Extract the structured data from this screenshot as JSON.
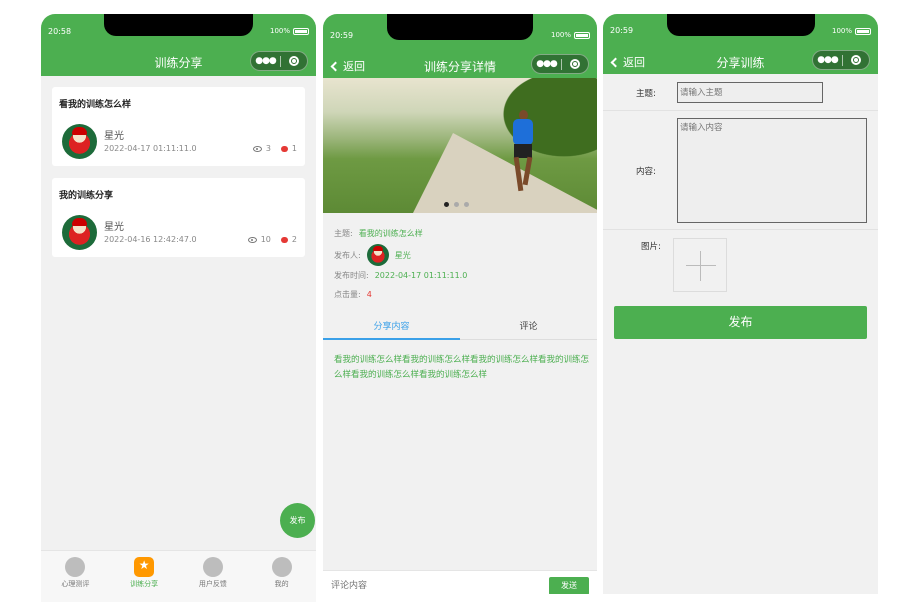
{
  "colors": {
    "brand": "#4caf50",
    "accent_blue": "#3aa0e8",
    "alert_red": "#e53935"
  },
  "panel1": {
    "status": {
      "time": "20:58",
      "battery": "100%"
    },
    "title": "训练分享",
    "posts": [
      {
        "title": "看我的训练怎么样",
        "user": "星光",
        "time": "2022-04-17 01:11:11.0",
        "views": "3",
        "comments": "1"
      },
      {
        "title": "我的训练分享",
        "user": "星光",
        "time": "2022-04-16 12:42:47.0",
        "views": "10",
        "comments": "2"
      }
    ],
    "fab": "发布",
    "tabs": [
      {
        "label": "心理测评",
        "icon": "pencil-icon"
      },
      {
        "label": "训练分享",
        "icon": "star-icon"
      },
      {
        "label": "用户反馈",
        "icon": "feedback-icon"
      },
      {
        "label": "我的",
        "icon": "user-icon"
      }
    ]
  },
  "panel2": {
    "status": {
      "time": "20:59",
      "battery": "100%"
    },
    "back": "返回",
    "title": "训练分享详情",
    "fields": {
      "topic_label": "主题:",
      "topic": "看我的训练怎么样",
      "author_label": "发布人:",
      "author": "星光",
      "time_label": "发布时间:",
      "time": "2022-04-17 01:11:11.0",
      "clicks_label": "点击量:",
      "clicks": "4"
    },
    "tabs": [
      "分享内容",
      "评论"
    ],
    "content": "看我的训练怎么样看我的训练怎么样看我的训练怎么样看我的训练怎么样看我的训练怎么样看我的训练怎么样",
    "comment_placeholder": "评论内容",
    "send": "发送"
  },
  "panel3": {
    "status": {
      "time": "20:59",
      "battery": "100%"
    },
    "back": "返回",
    "title": "分享训练",
    "topic_label": "主题:",
    "topic_placeholder": "请输入主题",
    "content_label": "内容:",
    "content_placeholder": "请输入内容",
    "image_label": "图片:",
    "publish": "发布"
  }
}
